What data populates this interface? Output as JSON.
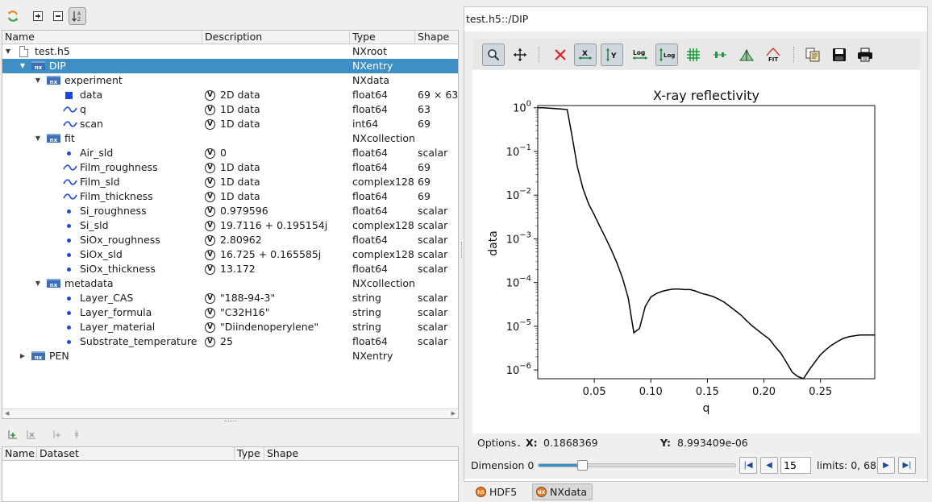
{
  "tree": {
    "columns": [
      "Name",
      "Description",
      "Type",
      "Shape"
    ],
    "rows": [
      {
        "name": "test.h5",
        "desc": "",
        "type": "NXroot",
        "shape": "",
        "icon": "file-icon",
        "arrow": "down",
        "indent": 0
      },
      {
        "name": "DIP",
        "desc": "",
        "type": "NXentry",
        "shape": "",
        "icon": "nx-folder-icon",
        "arrow": "down",
        "indent": 1,
        "selected": true
      },
      {
        "name": "experiment",
        "desc": "",
        "type": "NXdata",
        "shape": "",
        "icon": "nx-folder-icon",
        "arrow": "down",
        "indent": 2
      },
      {
        "name": "data",
        "desc": "2D data",
        "type": "float64",
        "shape": "69 × 63",
        "icon": "image-dataset-icon",
        "indent": 3,
        "v": true
      },
      {
        "name": "q",
        "desc": "1D data",
        "type": "float64",
        "shape": "63",
        "icon": "curve-dataset-icon",
        "indent": 3,
        "v": true
      },
      {
        "name": "scan",
        "desc": "1D data",
        "type": "int64",
        "shape": "69",
        "icon": "curve-dataset-icon",
        "indent": 3,
        "v": true
      },
      {
        "name": "fit",
        "desc": "",
        "type": "NXcollection",
        "shape": "",
        "icon": "nx-folder-icon",
        "arrow": "down",
        "indent": 2
      },
      {
        "name": "Air_sld",
        "desc": "0",
        "type": "float64",
        "shape": "scalar",
        "icon": "scalar-dataset-icon",
        "indent": 3,
        "v": true
      },
      {
        "name": "Film_roughness",
        "desc": "1D data",
        "type": "float64",
        "shape": "69",
        "icon": "curve-dataset-icon",
        "indent": 3,
        "v": true
      },
      {
        "name": "Film_sld",
        "desc": "1D data",
        "type": "complex128",
        "shape": "69",
        "icon": "curve-dataset-icon",
        "indent": 3,
        "v": true
      },
      {
        "name": "Film_thickness",
        "desc": "1D data",
        "type": "float64",
        "shape": "69",
        "icon": "curve-dataset-icon",
        "indent": 3,
        "v": true
      },
      {
        "name": "Si_roughness",
        "desc": "0.979596",
        "type": "float64",
        "shape": "scalar",
        "icon": "scalar-dataset-icon",
        "indent": 3,
        "v": true
      },
      {
        "name": "Si_sld",
        "desc": "19.7116 + 0.195154j",
        "type": "complex128",
        "shape": "scalar",
        "icon": "scalar-dataset-icon",
        "indent": 3,
        "v": true
      },
      {
        "name": "SiOx_roughness",
        "desc": "2.80962",
        "type": "float64",
        "shape": "scalar",
        "icon": "scalar-dataset-icon",
        "indent": 3,
        "v": true
      },
      {
        "name": "SiOx_sld",
        "desc": "16.725 + 0.165585j",
        "type": "complex128",
        "shape": "scalar",
        "icon": "scalar-dataset-icon",
        "indent": 3,
        "v": true
      },
      {
        "name": "SiOx_thickness",
        "desc": "13.172",
        "type": "float64",
        "shape": "scalar",
        "icon": "scalar-dataset-icon",
        "indent": 3,
        "v": true
      },
      {
        "name": "metadata",
        "desc": "",
        "type": "NXcollection",
        "shape": "",
        "icon": "nx-folder-icon",
        "arrow": "down",
        "indent": 2
      },
      {
        "name": "Layer_CAS",
        "desc": "\"188-94-3\"",
        "type": "string",
        "shape": "scalar",
        "icon": "scalar-dataset-icon",
        "indent": 3,
        "v": true
      },
      {
        "name": "Layer_formula",
        "desc": "\"C32H16\"",
        "type": "string",
        "shape": "scalar",
        "icon": "scalar-dataset-icon",
        "indent": 3,
        "v": true
      },
      {
        "name": "Layer_material",
        "desc": "\"Diindenoperylene\"",
        "type": "string",
        "shape": "scalar",
        "icon": "scalar-dataset-icon",
        "indent": 3,
        "v": true
      },
      {
        "name": "Substrate_temperature",
        "desc": "25",
        "type": "float64",
        "shape": "scalar",
        "icon": "scalar-dataset-icon",
        "indent": 3,
        "v": true
      },
      {
        "name": "PEN",
        "desc": "",
        "type": "NXentry",
        "shape": "",
        "icon": "nx-folder-icon",
        "arrow": "right",
        "indent": 1
      }
    ]
  },
  "dataset_table": {
    "columns": [
      "Name",
      "Dataset",
      "Type",
      "Shape"
    ]
  },
  "viewer": {
    "title": "test.h5::/DIP",
    "options_label": "Options",
    "x_label": "X:",
    "x_value": "0.1868369",
    "y_label": "Y:",
    "y_value": "8.993409e-06",
    "dimension_label": "Dimension 0",
    "dimension_value": "15",
    "slider_fraction": 0.22,
    "limits_text": "limits: 0, 68",
    "tabs": [
      {
        "label": "HDF5",
        "badge": "h5",
        "active": false
      },
      {
        "label": "NXdata",
        "badge": "NX",
        "active": true
      }
    ]
  },
  "chart_data": {
    "type": "line",
    "title": "X-ray reflectivity",
    "xlabel": "q",
    "ylabel": "data",
    "y_scale": "log",
    "xlim": [
      0.0,
      0.298
    ],
    "ylim_exponent": [
      -6.2,
      0.05
    ],
    "xticks": [
      "0.05",
      "0.10",
      "0.15",
      "0.20",
      "0.25"
    ],
    "xtick_values": [
      0.05,
      0.1,
      0.15,
      0.2,
      0.25
    ],
    "ytick_exponents": [
      0,
      -1,
      -2,
      -3,
      -4,
      -5,
      -6
    ],
    "grid": false,
    "color": "#000000",
    "series": [
      {
        "x": [
          0.0,
          0.005,
          0.01,
          0.015,
          0.02,
          0.026,
          0.03,
          0.035,
          0.04,
          0.045,
          0.05,
          0.055,
          0.06,
          0.065,
          0.07,
          0.075,
          0.08,
          0.085,
          0.09,
          0.095,
          0.1,
          0.105,
          0.11,
          0.115,
          0.12,
          0.125,
          0.13,
          0.135,
          0.14,
          0.145,
          0.15,
          0.155,
          0.16,
          0.165,
          0.17,
          0.175,
          0.18,
          0.185,
          0.19,
          0.195,
          0.2,
          0.205,
          0.21,
          0.215,
          0.22,
          0.225,
          0.23,
          0.235,
          0.24,
          0.245,
          0.25,
          0.255,
          0.26,
          0.265,
          0.27,
          0.275,
          0.28,
          0.285,
          0.29,
          0.298
        ],
        "y_log10": [
          0.0,
          0.0,
          -0.01,
          -0.02,
          -0.03,
          -0.04,
          -0.6,
          -1.35,
          -1.85,
          -2.2,
          -2.45,
          -2.72,
          -2.98,
          -3.25,
          -3.55,
          -3.9,
          -4.35,
          -5.15,
          -5.05,
          -4.55,
          -4.33,
          -4.25,
          -4.2,
          -4.17,
          -4.15,
          -4.15,
          -4.16,
          -4.16,
          -4.2,
          -4.25,
          -4.28,
          -4.32,
          -4.38,
          -4.45,
          -4.55,
          -4.65,
          -4.75,
          -4.88,
          -5.0,
          -5.1,
          -5.2,
          -5.3,
          -5.47,
          -5.62,
          -5.83,
          -6.05,
          -6.15,
          -6.2,
          -6.0,
          -5.82,
          -5.65,
          -5.53,
          -5.43,
          -5.35,
          -5.28,
          -5.24,
          -5.22,
          -5.2,
          -5.2,
          -5.2
        ]
      }
    ]
  }
}
